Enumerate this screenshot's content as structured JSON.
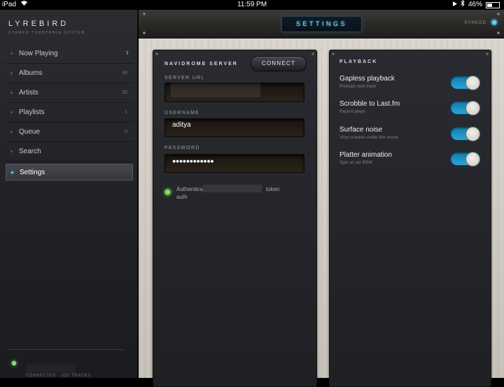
{
  "status_bar": {
    "carrier": "iPad",
    "time": "11:59 PM",
    "battery": "46%",
    "battery_fraction": 0.46,
    "icons": [
      "wifi-icon",
      "play-icon",
      "bluetooth-icon",
      "battery-icon"
    ]
  },
  "sidebar": {
    "brand_title": "LYREBIRD",
    "brand_subtitle": "STEREO TURNTABLE SYSTEM",
    "items": [
      {
        "label": "Now Playing",
        "count": "",
        "chevron": true
      },
      {
        "label": "Albums",
        "count": "48"
      },
      {
        "label": "Artists",
        "count": "35"
      },
      {
        "label": "Playlists",
        "count": "1"
      },
      {
        "label": "Queue",
        "count": "0"
      },
      {
        "label": "Search",
        "count": ""
      },
      {
        "label": "Settings",
        "count": "",
        "active": true
      }
    ],
    "connection_status": "CONNECTED · 350 TRACKS"
  },
  "header": {
    "title": "SETTINGS",
    "sync_status": "SYNCED"
  },
  "server_panel": {
    "title": "NAVIDROME SERVER",
    "connect_label": "CONNECT",
    "server_url_label": "SERVER URL",
    "server_url_value": "",
    "username_label": "USERNAME",
    "username_value": "aditya",
    "password_label": "PASSWORD",
    "password_value": "●●●●●●●●●●●●",
    "auth_line1": "Authentica",
    "auth_token": "token",
    "auth_line2": "auth"
  },
  "playback_panel": {
    "title": "PLAYBACK",
    "settings": [
      {
        "label": "Gapless playback",
        "description": "Preload next track",
        "enabled": true
      },
      {
        "label": "Scrobble to Last.fm",
        "description": "Report plays",
        "enabled": true
      },
      {
        "label": "Surface noise",
        "description": "Vinyl crackle under the music",
        "enabled": true
      },
      {
        "label": "Platter animation",
        "description": "Spin at set RPM",
        "enabled": true
      }
    ]
  },
  "colors": {
    "accent_blue": "#2aa6d8",
    "led_green": "#66d84c",
    "title_glow": "#a5dcf5"
  }
}
